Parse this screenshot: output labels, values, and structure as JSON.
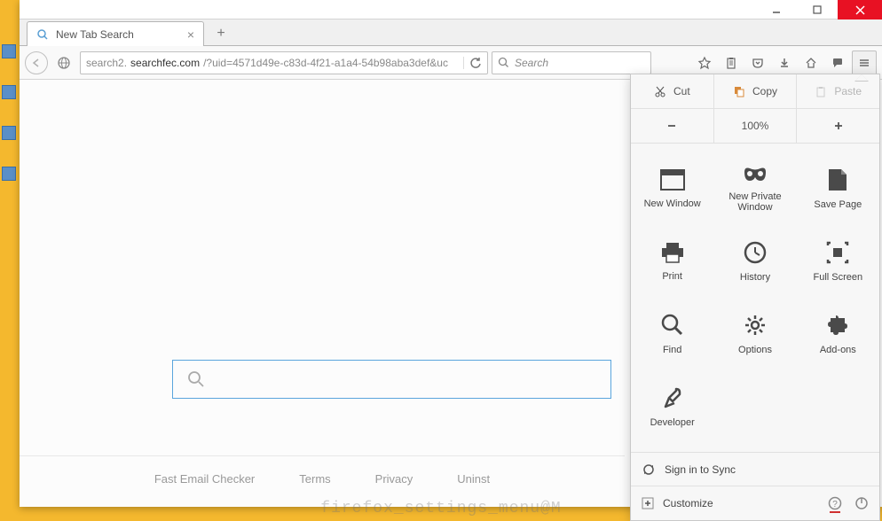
{
  "window": {
    "tab_title": "New Tab Search"
  },
  "url": {
    "prefix": "search2.",
    "host": "searchfec.com",
    "path": "/?uid=4571d49e-c83d-4f21-a1a4-54b98aba3def&uc"
  },
  "searchbar": {
    "placeholder": "Search"
  },
  "footer_links": [
    "Fast Email Checker",
    "Terms",
    "Privacy",
    "Uninst"
  ],
  "menu": {
    "edit": {
      "cut": "Cut",
      "copy": "Copy",
      "paste": "Paste"
    },
    "zoom": {
      "level": "100%"
    },
    "grid": [
      {
        "label": "New Window",
        "icon": "new-window-icon"
      },
      {
        "label": "New Private Window",
        "icon": "private-window-icon"
      },
      {
        "label": "Save Page",
        "icon": "save-page-icon"
      },
      {
        "label": "Print",
        "icon": "print-icon"
      },
      {
        "label": "History",
        "icon": "history-icon"
      },
      {
        "label": "Full Screen",
        "icon": "fullscreen-icon"
      },
      {
        "label": "Find",
        "icon": "find-icon"
      },
      {
        "label": "Options",
        "icon": "options-icon"
      },
      {
        "label": "Add-ons",
        "icon": "addons-icon"
      },
      {
        "label": "Developer",
        "icon": "developer-icon"
      }
    ],
    "sync": "Sign in to Sync",
    "customize": "Customize"
  },
  "watermark": "firefox_settings_menu@M"
}
